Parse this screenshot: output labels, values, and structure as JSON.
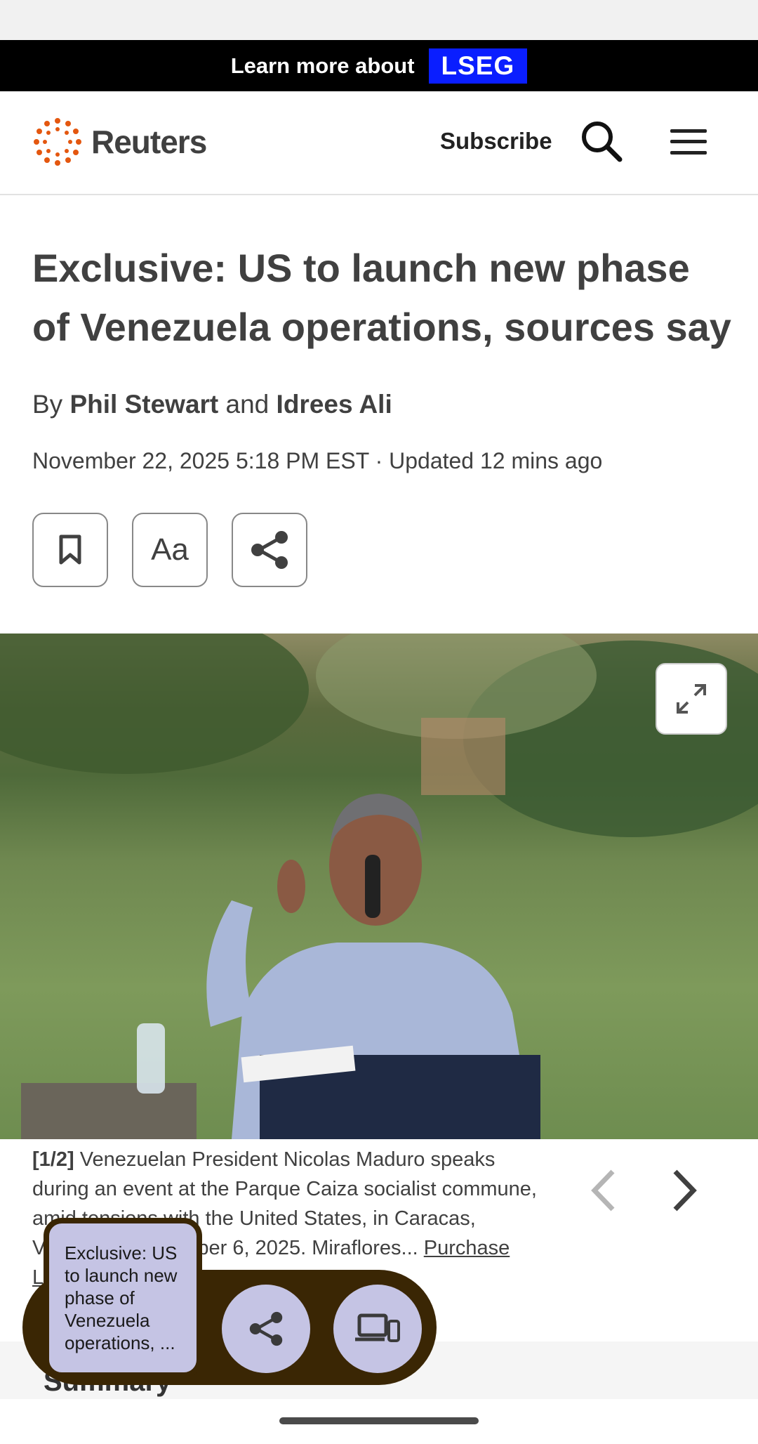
{
  "ad": {
    "text": "Learn more about",
    "brand": "LSEG",
    "brand_color": "#0a1eff"
  },
  "header": {
    "logo_text": "Reuters",
    "subscribe_label": "Subscribe",
    "icons": [
      "reuters-logo-icon",
      "search-icon",
      "menu-icon"
    ]
  },
  "article": {
    "headline": "Exclusive: US to launch new phase of Venezuela operations, sources say",
    "byline": {
      "prefix": "By",
      "author1": "Phil Stewart",
      "joiner": "and",
      "author2": "Idrees Ali"
    },
    "dateline": "November 22, 2025 5:18 PM EST · Updated 12 mins ago",
    "tools": {
      "text_size_label": "Aa",
      "icons": [
        "bookmark-icon",
        "share-icon"
      ]
    },
    "photo": {
      "expand_icon": "expand-icon",
      "caption_counter": "[1/2]",
      "caption_text": "Venezuelan President Nicolas Maduro speaks during an event at the Parque Caiza socialist commune, amid tensions with the United States, in Caracas, Venezuela November 6, 2025. Miraflores...",
      "purchase_link": "Purchase Licensing Rights"
    },
    "summary_title": "Summary"
  },
  "overlay": {
    "card_text": "Exclusive: US to launch new phase of Venezuela operations, ...",
    "icons": [
      "share-icon",
      "devices-icon"
    ],
    "background": "#3a2604",
    "accent": "#c5c4e4"
  }
}
